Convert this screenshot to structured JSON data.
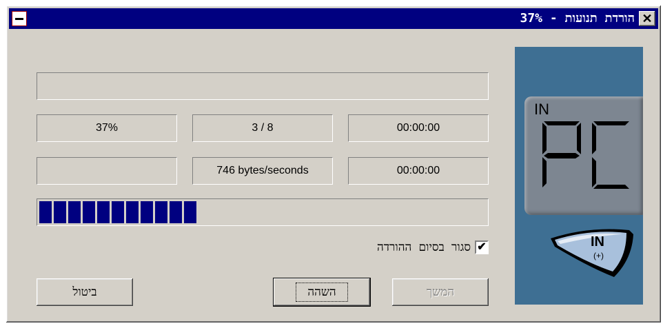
{
  "window": {
    "title": "הורדת תנועות - 37%",
    "close_glyph": "✕",
    "sysmenu_icon": "minus-icon",
    "title_bar_color": "#000080",
    "face_color": "#d4d0c8"
  },
  "status": {
    "message": "",
    "percent": "37%",
    "files": "3 / 8",
    "elapsed": "00:00:00",
    "extra": "",
    "speed": "746 bytes/seconds",
    "remaining": "00:00:00"
  },
  "progress": {
    "fraction": 0.37,
    "segment_color": "#000080"
  },
  "options": {
    "close_on_finish_label": "סגור בסיום ההורדה",
    "close_on_finish_checked": true,
    "check_glyph": "✔"
  },
  "buttons": {
    "cancel": "ביטול",
    "pause": "השהה",
    "continue": "המשך"
  },
  "side_panel": {
    "lcd_caption": "IN",
    "lcd_text": "PC",
    "in_button_label": "IN",
    "in_button_sub": "(+)",
    "panel_color": "#3e6f93"
  }
}
